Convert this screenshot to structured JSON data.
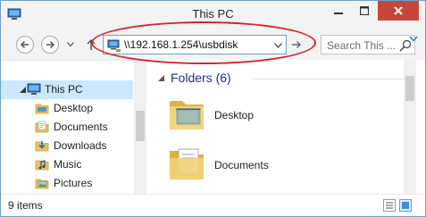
{
  "window": {
    "title": "This PC",
    "controls": {
      "minimize": "minimize",
      "maximize": "maximize",
      "close": "close"
    }
  },
  "navbar": {
    "address": "\\\\192.168.1.254\\usbdisk",
    "search_placeholder": "Search This ..."
  },
  "nav_pane": {
    "root": {
      "label": "This PC",
      "icon": "computer-icon"
    },
    "items": [
      {
        "label": "Desktop",
        "icon": "folder-icon"
      },
      {
        "label": "Documents",
        "icon": "documents-folder-icon"
      },
      {
        "label": "Downloads",
        "icon": "downloads-folder-icon"
      },
      {
        "label": "Music",
        "icon": "music-folder-icon"
      },
      {
        "label": "Pictures",
        "icon": "pictures-folder-icon"
      }
    ]
  },
  "content": {
    "group_title": "Folders (6)",
    "folders": [
      {
        "label": "Desktop",
        "icon": "desktop-folder-icon"
      },
      {
        "label": "Documents",
        "icon": "documents-folder-icon"
      }
    ]
  },
  "status": {
    "item_count": "9 items"
  },
  "colors": {
    "accent": "#1e3287",
    "selection": "#cce8ff",
    "close_button": "#c7463c",
    "annotation_oval": "#d5232a",
    "folder": "#e8c25d"
  }
}
